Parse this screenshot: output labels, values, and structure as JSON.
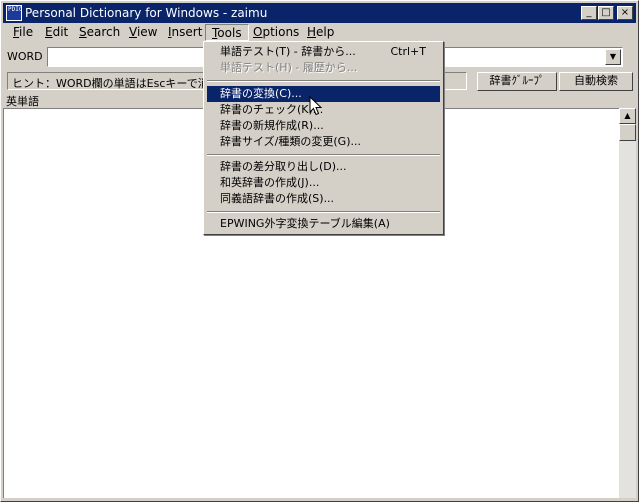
{
  "window": {
    "title": "Personal Dictionary for Windows - zaimu",
    "app_icon_text": "PDIC",
    "minimize_glyph": "_",
    "maximize_glyph": "□",
    "close_glyph": "×"
  },
  "menubar": {
    "items": [
      {
        "label": "File",
        "mnemonic": "F",
        "rest": "ile"
      },
      {
        "label": "Edit",
        "mnemonic": "E",
        "rest": "dit"
      },
      {
        "label": "Search",
        "mnemonic": "S",
        "rest": "earch"
      },
      {
        "label": "View",
        "mnemonic": "V",
        "rest": "iew"
      },
      {
        "label": "Insert",
        "mnemonic": "I",
        "rest": "nsert"
      },
      {
        "label": "Tools",
        "mnemonic": "T",
        "rest": "ools"
      },
      {
        "label": "Options",
        "mnemonic": "O",
        "rest": "ptions"
      },
      {
        "label": "Help",
        "mnemonic": "H",
        "rest": "elp"
      }
    ]
  },
  "word_row": {
    "label": "WORD",
    "value": "",
    "dropdown_glyph": "▼"
  },
  "hint_row": {
    "hint_text": "ヒント：WORD欄の単語はEscキーで消",
    "buttons": {
      "dict_group": "辞書ｸﾞﾙｰﾌﾟ",
      "auto_search": "自動検索"
    }
  },
  "list": {
    "header": "英単語"
  },
  "scrollbar": {
    "up_glyph": "▲"
  },
  "tools_menu": {
    "items": [
      {
        "label": "単語テスト(T) - 辞書から...",
        "shortcut": "Ctrl+T",
        "state": "normal"
      },
      {
        "label": "単語テスト(H) - 履歴から...",
        "shortcut": "",
        "state": "disabled"
      },
      {
        "label": "辞書の変換(C)...",
        "shortcut": "",
        "state": "selected"
      },
      {
        "label": "辞書のチェック(K)...",
        "shortcut": "",
        "state": "normal"
      },
      {
        "label": "辞書の新規作成(R)...",
        "shortcut": "",
        "state": "normal"
      },
      {
        "label": "辞書サイズ/種類の変更(G)...",
        "shortcut": "",
        "state": "normal"
      },
      {
        "label": "辞書の差分取り出し(D)...",
        "shortcut": "",
        "state": "normal"
      },
      {
        "label": "和英辞書の作成(J)...",
        "shortcut": "",
        "state": "normal"
      },
      {
        "label": "同義語辞書の作成(S)...",
        "shortcut": "",
        "state": "normal"
      },
      {
        "label": "EPWING外字変換テーブル編集(A)",
        "shortcut": "",
        "state": "normal"
      }
    ]
  },
  "colors": {
    "title_bar": "#0a246a",
    "face": "#d4d0c8",
    "highlight": "#0a246a"
  }
}
